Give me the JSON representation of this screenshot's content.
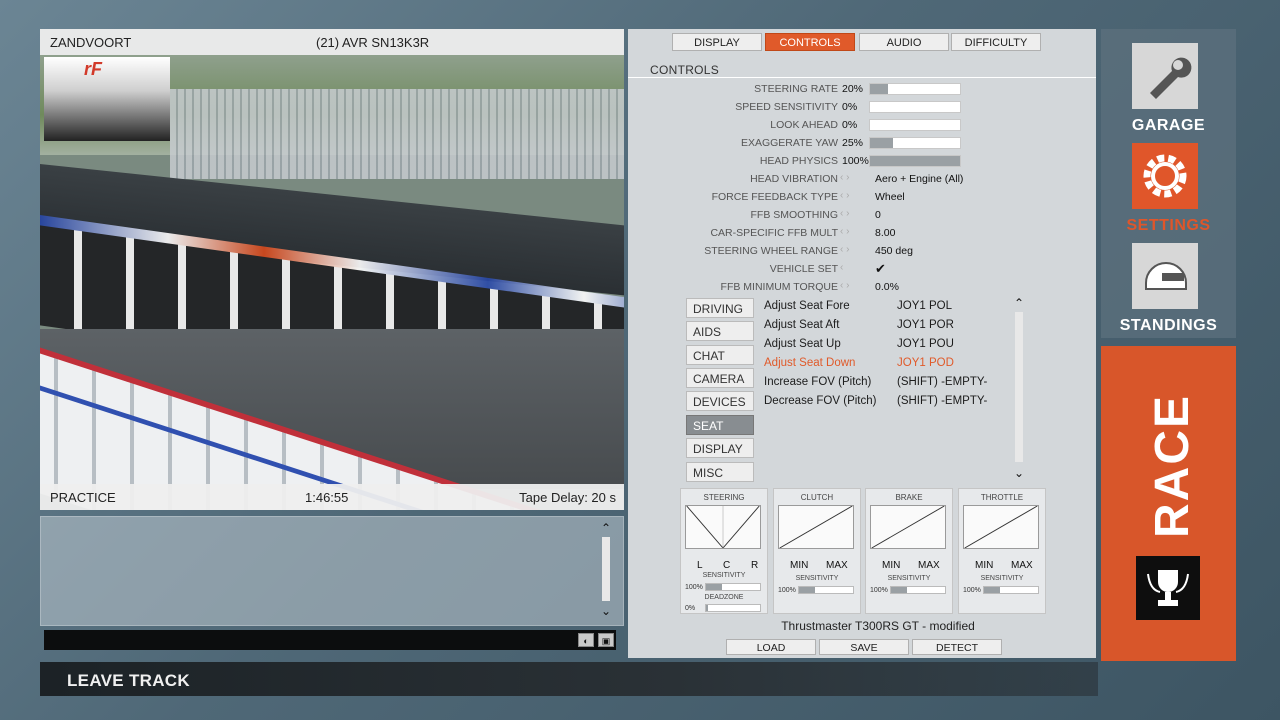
{
  "video": {
    "track": "ZANDVOORT",
    "driver": "(21) AVR SN13K3R",
    "session": "PRACTICE",
    "time": "1:46:55",
    "tape_delay": "Tape Delay: 20 s",
    "logo_text": "rF"
  },
  "leave_track": "LEAVE TRACK",
  "tabs": [
    "DISPLAY",
    "CONTROLS",
    "AUDIO",
    "DIFFICULTY"
  ],
  "active_tab": "CONTROLS",
  "section_title": "CONTROLS",
  "settings": [
    {
      "label": "STEERING RATE",
      "value": "20%",
      "level": 0.2
    },
    {
      "label": "SPEED SENSITIVITY",
      "value": "0%",
      "level": 0
    },
    {
      "label": "LOOK AHEAD",
      "value": "0%",
      "level": 0
    },
    {
      "label": "EXAGGERATE YAW",
      "value": "25%",
      "level": 0.25
    },
    {
      "label": "HEAD PHYSICS",
      "value": "100%",
      "level": 1
    }
  ],
  "selects": [
    {
      "label": "HEAD VIBRATION",
      "value": "Aero + Engine (All)"
    },
    {
      "label": "FORCE FEEDBACK TYPE",
      "value": "Wheel"
    },
    {
      "label": "FFB SMOOTHING",
      "value": "0"
    },
    {
      "label": "CAR-SPECIFIC FFB MULT",
      "value": "8.00"
    },
    {
      "label": "STEERING WHEEL RANGE",
      "value": "450 deg"
    },
    {
      "label": "VEHICLE SET",
      "value": "✔"
    },
    {
      "label": "FFB MINIMUM TORQUE",
      "value": "0.0%"
    }
  ],
  "categories": [
    "DRIVING",
    "AIDS",
    "CHAT",
    "CAMERA",
    "DEVICES",
    "SEAT",
    "DISPLAY",
    "MISC"
  ],
  "active_category": "SEAT",
  "bindings": [
    {
      "action": "Adjust Seat Fore",
      "key": "JOY1 POL"
    },
    {
      "action": "Adjust Seat Aft",
      "key": "JOY1 POR"
    },
    {
      "action": "Adjust Seat Up",
      "key": "JOY1 POU"
    },
    {
      "action": "Adjust Seat Down",
      "key": "JOY1 POD"
    },
    {
      "action": "Increase FOV (Pitch)",
      "key": "(SHIFT) -EMPTY-"
    },
    {
      "action": "Decrease FOV (Pitch)",
      "key": "(SHIFT) -EMPTY-"
    }
  ],
  "highlighted_binding": "Adjust Seat Down",
  "pedals": {
    "steering": {
      "title": "STEERING",
      "l": "L",
      "c": "C",
      "r": "R",
      "sensitivity": "SENSITIVITY",
      "sens_pct": "100%",
      "deadzone": "DEADZONE",
      "dead_pct": "0%"
    },
    "clutch": {
      "title": "CLUTCH",
      "min": "MIN",
      "max": "MAX",
      "sensitivity": "SENSITIVITY",
      "sens_pct": "100%"
    },
    "brake": {
      "title": "BRAKE",
      "min": "MIN",
      "max": "MAX",
      "sensitivity": "SENSITIVITY",
      "sens_pct": "100%"
    },
    "throttle": {
      "title": "THROTTLE",
      "min": "MIN",
      "max": "MAX",
      "sensitivity": "SENSITIVITY",
      "sens_pct": "100%"
    }
  },
  "device": "Thrustmaster T300RS GT - modified",
  "device_buttons": [
    "LOAD",
    "SAVE",
    "DETECT"
  ],
  "nav": {
    "garage": "GARAGE",
    "settings": "SETTINGS",
    "standings": "STANDINGS",
    "race": "RACE"
  },
  "colors": {
    "accent": "#e05a2a"
  }
}
